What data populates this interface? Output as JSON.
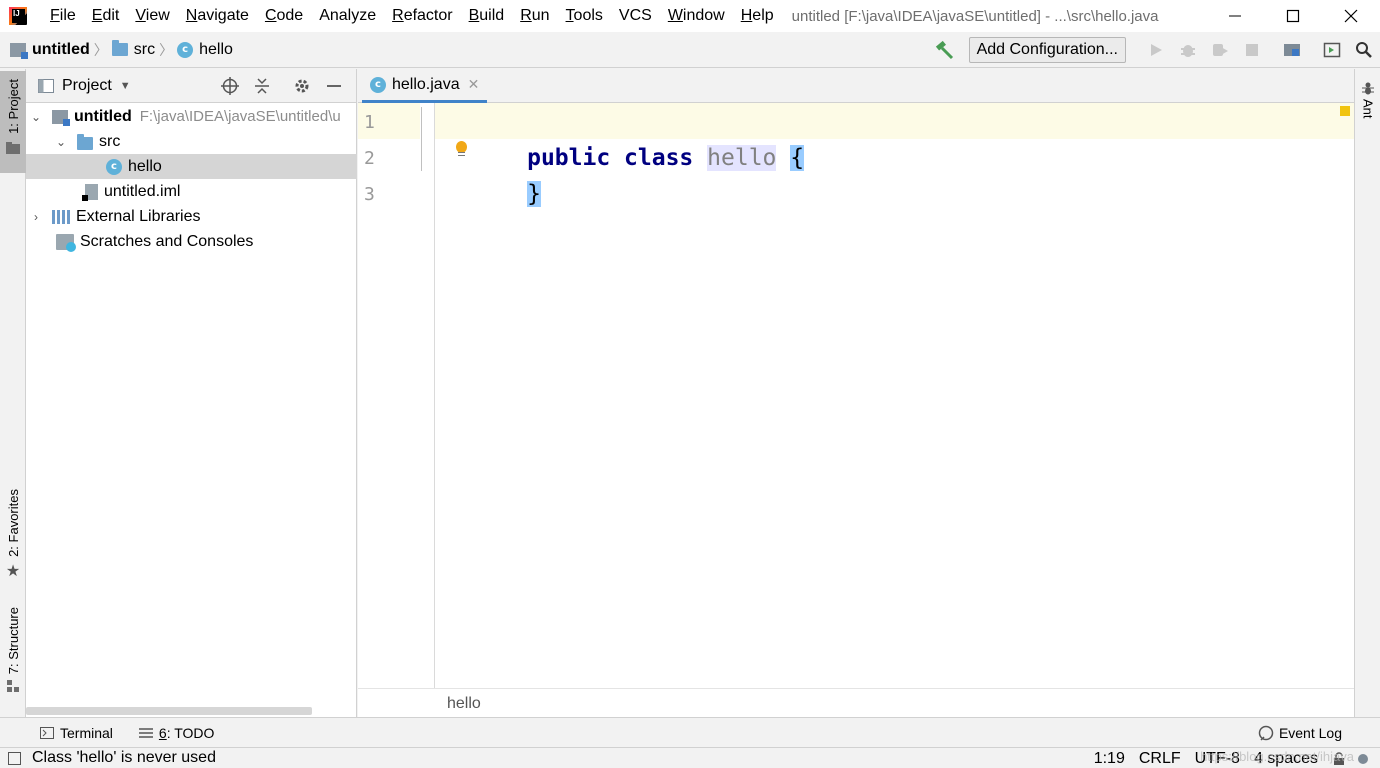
{
  "window": {
    "title": "untitled [F:\\java\\IDEA\\javaSE\\untitled] - ...\\src\\hello.java"
  },
  "menu": [
    {
      "label": "File",
      "mnemonic": "F",
      "rest": "ile"
    },
    {
      "label": "Edit",
      "mnemonic": "E",
      "rest": "dit"
    },
    {
      "label": "View",
      "mnemonic": "V",
      "rest": "iew"
    },
    {
      "label": "Navigate",
      "mnemonic": "N",
      "rest": "avigate"
    },
    {
      "label": "Code",
      "mnemonic": "C",
      "rest": "ode"
    },
    {
      "label": "Analyze",
      "mnemonic": "",
      "rest": "Analyze"
    },
    {
      "label": "Refactor",
      "mnemonic": "R",
      "rest": "efactor"
    },
    {
      "label": "Build",
      "mnemonic": "B",
      "rest": "uild"
    },
    {
      "label": "Run",
      "mnemonic": "R",
      "rest": "un"
    },
    {
      "label": "Tools",
      "mnemonic": "T",
      "rest": "ools"
    },
    {
      "label": "VCS",
      "mnemonic": "",
      "rest": "VCS"
    },
    {
      "label": "Window",
      "mnemonic": "W",
      "rest": "indow"
    },
    {
      "label": "Help",
      "mnemonic": "H",
      "rest": "elp"
    }
  ],
  "breadcrumbs": {
    "project": "untitled",
    "folder": "src",
    "file": "hello"
  },
  "toolbar": {
    "add_config_label": "Add Configuration..."
  },
  "left_tabs": {
    "project": "1: Project",
    "favorites": "2: Favorites",
    "structure": "7: Structure"
  },
  "right_tabs": {
    "ant": "Ant"
  },
  "project_panel": {
    "title": "Project",
    "tree": {
      "root_label": "untitled",
      "root_path": "F:\\java\\IDEA\\javaSE\\untitled\\u",
      "src_label": "src",
      "hello_label": "hello",
      "iml_label": "untitled.iml",
      "libs_label": "External Libraries",
      "scratches_label": "Scratches and Consoles"
    }
  },
  "editor": {
    "tab_label": "hello.java",
    "line_numbers": [
      "1",
      "2",
      "3"
    ],
    "code": {
      "kw_public": "public",
      "kw_class": "class",
      "class_name": "hello",
      "open_brace": "{",
      "close_brace": "}"
    },
    "breadcrumb": "hello"
  },
  "bottom_tools": {
    "terminal": "Terminal",
    "todo_mnemonic": "6",
    "todo_rest": ": TODO",
    "event_log": "Event Log"
  },
  "status": {
    "message": "Class 'hello' is never used",
    "position": "1:19",
    "line_sep": "CRLF",
    "encoding": "UTF-8",
    "indent": "4 spaces",
    "watermark": "https://blog.csdn.net/ihjava"
  },
  "colors": {
    "keyword": "#000080",
    "unused": "#808080",
    "brace_match": "#99ccff",
    "caret_line": "#fdfbe6",
    "tab_underline": "#4083c9"
  }
}
